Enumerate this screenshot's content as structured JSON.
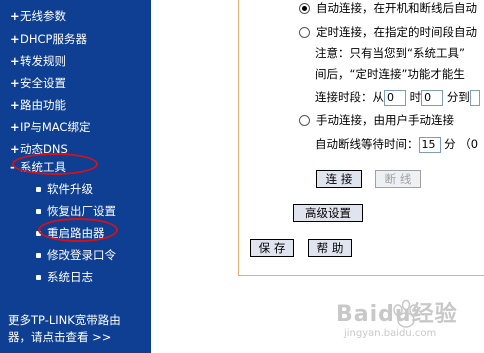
{
  "sidebar": {
    "items": [
      {
        "label": "无线参数"
      },
      {
        "label": "DHCP服务器"
      },
      {
        "label": "转发规则"
      },
      {
        "label": "安全设置"
      },
      {
        "label": "路由功能"
      },
      {
        "label": "IP与MAC绑定"
      },
      {
        "label": "动态DNS"
      },
      {
        "label": "系统工具"
      }
    ],
    "subitems": [
      {
        "label": "软件升级"
      },
      {
        "label": "恢复出厂设置"
      },
      {
        "label": "重启路由器"
      },
      {
        "label": "修改登录口令"
      },
      {
        "label": "系统日志"
      }
    ],
    "more_line1": "更多TP-LINK宽带路由",
    "more_line2": "器，请点击查看 >>"
  },
  "main": {
    "auto_connect": "自动连接，在开机和断线后自动",
    "timed_connect": "定时连接，在指定的时间段自动",
    "note_line1": "注意：只有当您到“系统工具”",
    "note_line2": "间后，“定时连接”功能才能生",
    "period_label": "连接时段：从",
    "period_from": "0",
    "period_hour": "时",
    "period_to": "0",
    "period_to_label": "分到",
    "manual_connect": "手动连接，由用户手动连接",
    "idle_label": "自动断线等待时间：",
    "idle_value": "15",
    "idle_unit": "分 （0",
    "connect_button": "连 接",
    "disconnect_button": "断 线",
    "advanced_button": "高级设置",
    "save_button": "保 存",
    "help_button": "帮 助"
  },
  "watermark": {
    "brand": "Baidu经验",
    "url": "jingyan.baidu.com"
  }
}
